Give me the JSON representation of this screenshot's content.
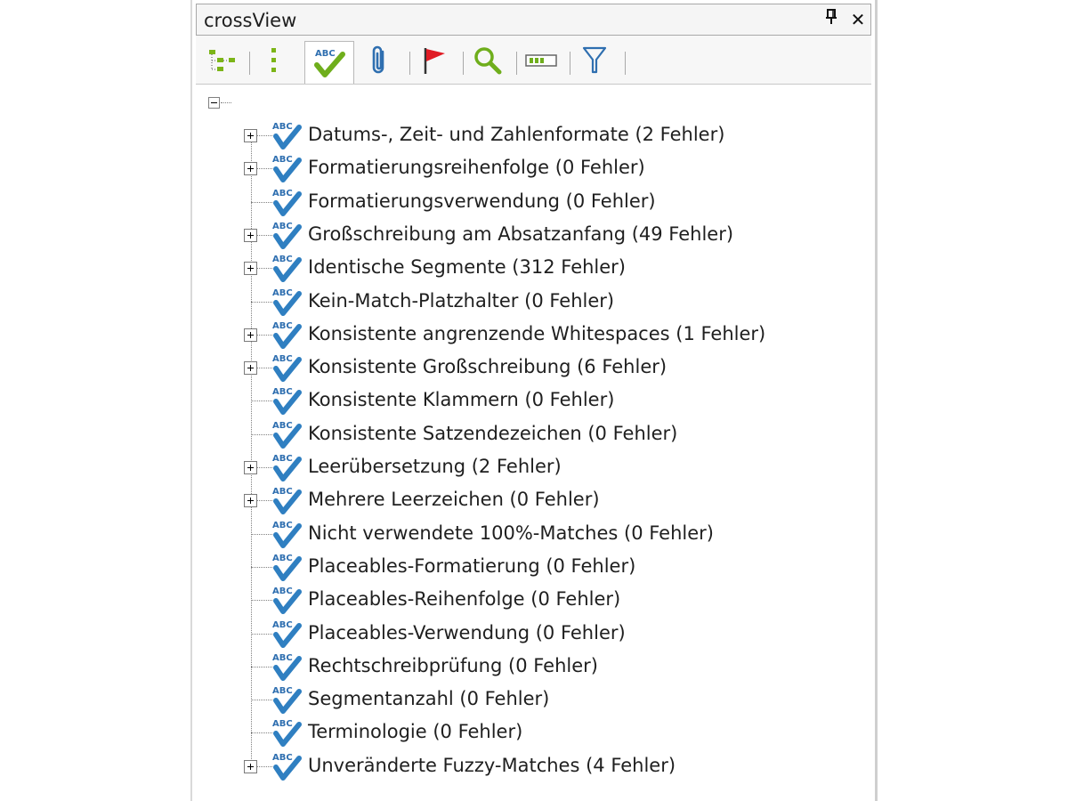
{
  "window": {
    "title": "crossView",
    "pin_icon": "pin-icon",
    "close_icon": "close-icon"
  },
  "toolbar": {
    "buttons": [
      {
        "name": "hierarchy-view-icon"
      },
      {
        "name": "list-view-icon"
      },
      {
        "name": "abc-check-icon",
        "active": true
      },
      {
        "name": "paperclip-icon"
      },
      {
        "name": "red-flag-icon"
      },
      {
        "name": "magnifier-icon"
      },
      {
        "name": "progress-bar-icon"
      },
      {
        "name": "filter-funnel-icon"
      }
    ]
  },
  "tree": {
    "root_expanded": true,
    "items": [
      {
        "label": "Datums-, Zeit- und Zahlenformate (2 Fehler)",
        "expandable": true
      },
      {
        "label": "Formatierungsreihenfolge (0 Fehler)",
        "expandable": true
      },
      {
        "label": "Formatierungsverwendung (0 Fehler)",
        "expandable": false
      },
      {
        "label": "Großschreibung am Absatzanfang (49 Fehler)",
        "expandable": true
      },
      {
        "label": "Identische Segmente (312 Fehler)",
        "expandable": true
      },
      {
        "label": "Kein-Match-Platzhalter (0 Fehler)",
        "expandable": false
      },
      {
        "label": "Konsistente angrenzende Whitespaces (1 Fehler)",
        "expandable": true
      },
      {
        "label": "Konsistente Großschreibung (6 Fehler)",
        "expandable": true
      },
      {
        "label": "Konsistente Klammern (0 Fehler)",
        "expandable": false
      },
      {
        "label": "Konsistente Satzendezeichen (0 Fehler)",
        "expandable": false
      },
      {
        "label": "Leerübersetzung (2 Fehler)",
        "expandable": true
      },
      {
        "label": "Mehrere Leerzeichen (0 Fehler)",
        "expandable": true
      },
      {
        "label": "Nicht verwendete 100%-Matches (0 Fehler)",
        "expandable": false
      },
      {
        "label": "Placeables-Formatierung (0 Fehler)",
        "expandable": false
      },
      {
        "label": "Placeables-Reihenfolge (0 Fehler)",
        "expandable": false
      },
      {
        "label": "Placeables-Verwendung (0 Fehler)",
        "expandable": false
      },
      {
        "label": "Rechtschreibprüfung (0 Fehler)",
        "expandable": false
      },
      {
        "label": "Segmentanzahl (0 Fehler)",
        "expandable": false
      },
      {
        "label": "Terminologie (0 Fehler)",
        "expandable": false
      },
      {
        "label": "Unveränderte Fuzzy-Matches (4 Fehler)",
        "expandable": true
      }
    ],
    "item_icon": "abc-spellcheck-icon",
    "icon_colors": {
      "check": "#2f7fc1",
      "text": "#2f6fb0"
    }
  }
}
